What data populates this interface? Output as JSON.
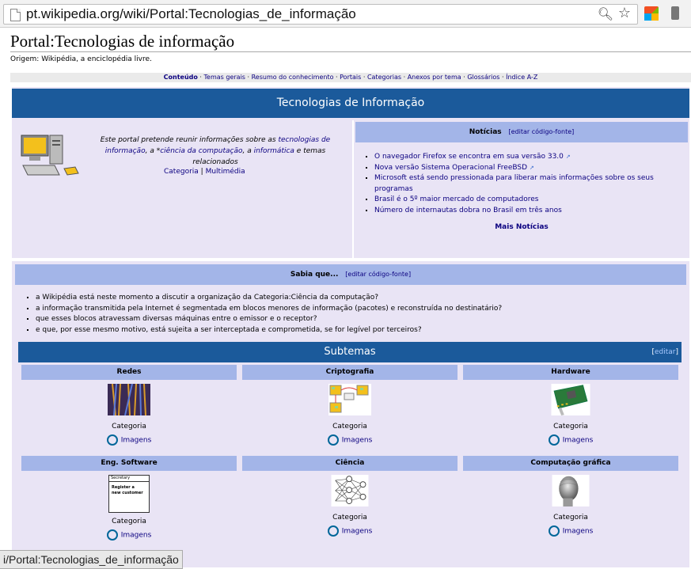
{
  "browser": {
    "url": "pt.wikipedia.org/wiki/Portal:Tecnologias_de_informação",
    "zoom_icon": "zoom-icon",
    "star_icon": "bookmark-star-icon"
  },
  "page": {
    "title": "Portal:Tecnologias de informação",
    "origin": "Origem: Wikipédia, a enciclopédia livre."
  },
  "topnav": {
    "items": [
      "Conteúdo",
      "Temas gerais",
      "Resumo do conhecimento",
      "Portais",
      "Categorias",
      "Anexos por tema",
      "Glossários",
      "Índice A-Z"
    ]
  },
  "portal": {
    "banner": "Tecnologias de Informação",
    "intro": {
      "text_1": "Este portal pretende reunir informações sobre as ",
      "link_1": "tecnologias de informação",
      "text_2": ", a *",
      "link_2": "ciência da computação",
      "text_3": ", a ",
      "link_3": "informática",
      "text_4": " e temas relacionados",
      "category": "Categoria",
      "sep": " | ",
      "multimedia": "Multimédia"
    },
    "news": {
      "title": "Notícias",
      "edit": "[editar código-fonte]",
      "items": [
        "O navegador Firefox se encontra em sua versão 33.0",
        "Nova versão Sistema Operacional FreeBSD",
        "Microsoft está sendo pressionada para liberar mais informações sobre os seus programas",
        "Brasil é o 5º maior mercado de computadores",
        "Número de internautas dobra no Brasil em três anos"
      ],
      "more": "Mais Notícias"
    },
    "sabia": {
      "title": "Sabia que...",
      "edit": "[editar código-fonte]",
      "items": [
        "a Wikipédia está neste momento a discutir a organização da Categoria:Ciência da computação?",
        "a informação transmitida pela Internet é segmentada em blocos menores de informação (pacotes) e reconstruída no destinatário?",
        "que esses blocos atravessam diversas máquinas entre o emissor e o receptor?",
        "e que, por esse mesmo motivo, está sujeita a ser interceptada e comprometida, se for legível por terceiros?"
      ]
    },
    "subtemas": {
      "title": "Subtemas",
      "edit_open": "[",
      "edit": "editar",
      "edit_close": "]",
      "cells": [
        {
          "name": "Redes",
          "category": "Categoria",
          "images": "Imagens"
        },
        {
          "name": "Criptografia",
          "category": "Categoria",
          "images": "Imagens"
        },
        {
          "name": "Hardware",
          "category": "Categoria",
          "images": "Imagens"
        },
        {
          "name": "Eng. Software",
          "category": "Categoria",
          "images": "Imagens"
        },
        {
          "name": "Ciência",
          "category": "Categoria",
          "images": "Imagens"
        },
        {
          "name": "Computação gráfica",
          "category": "Categoria",
          "images": "Imagens"
        }
      ],
      "eng_thumb": {
        "line1": "Secretary",
        "line2": "Register a",
        "line3": "new customer"
      }
    }
  },
  "status_bar": "i/Portal:Tecnologias_de_informação",
  "colors": {
    "banner": "#1b5a9b",
    "head": "#a3b5e8",
    "portal_bg": "#e9e4f5",
    "link": "#0b0080"
  }
}
